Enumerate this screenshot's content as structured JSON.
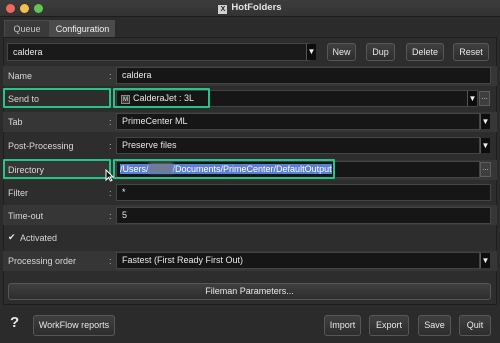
{
  "window": {
    "title": "HotFolders",
    "app_icon": "X"
  },
  "colors": {
    "highlight": "#25c487",
    "selection": "#5b7fd1",
    "close": "#ed6a5e",
    "minimize": "#f5bf4f",
    "maximize": "#61c554"
  },
  "tabs": [
    {
      "label": "Queue"
    },
    {
      "label": "Configuration"
    }
  ],
  "config": {
    "name_select": "caldera",
    "buttons": {
      "new": "New",
      "dup": "Dup",
      "delete": "Delete",
      "reset": "Reset"
    }
  },
  "form": {
    "name": {
      "label": "Name",
      "value": "caldera"
    },
    "send_to": {
      "label": "Send to",
      "value": "CalderaJet : 3L",
      "icon": "M"
    },
    "tab": {
      "label": "Tab",
      "value": "PrimeCenter ML"
    },
    "post_processing": {
      "label": "Post-Processing",
      "value": "Preserve files"
    },
    "directory": {
      "label": "Directory",
      "value_prefix": "/Users/",
      "value_suffix": "/Documents/PrimeCenter/DefaultOutput"
    },
    "filter": {
      "label": "Filter",
      "value": "*"
    },
    "timeout": {
      "label": "Time-out",
      "value": "5"
    },
    "activated": {
      "label": "Activated",
      "checked": true
    },
    "processing_order": {
      "label": "Processing order",
      "value": "Fastest (First Ready First Out)"
    },
    "colon": ":",
    "ellipsis": "..."
  },
  "fileman_button": "Fileman Parameters...",
  "footer": {
    "help": "?",
    "workflow": "WorkFlow reports",
    "import": "Import",
    "export": "Export",
    "save": "Save",
    "quit": "Quit"
  }
}
